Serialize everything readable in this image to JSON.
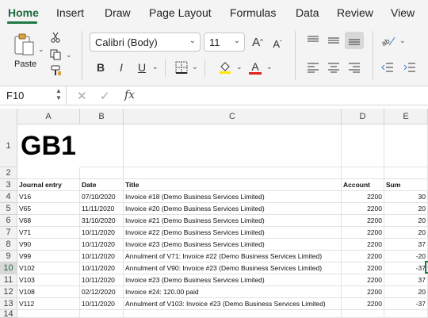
{
  "ribbon_tabs": [
    "Home",
    "Insert",
    "Draw",
    "Page Layout",
    "Formulas",
    "Data",
    "Review",
    "View"
  ],
  "ribbon": {
    "paste_label": "Paste",
    "font_name": "Calibri (Body)",
    "font_size": "11",
    "bold": "B",
    "italic": "I",
    "underline": "U",
    "grow_font": "A^",
    "shrink_font": "Aˇ",
    "font_color_letter": "A",
    "highlight_color": "#ffe600",
    "font_color": "#e02020"
  },
  "formula_bar": {
    "name_box": "F10",
    "fx": "fx",
    "formula": ""
  },
  "columns": [
    "A",
    "B",
    "C",
    "D",
    "E"
  ],
  "rows": [
    "1",
    "2",
    "3",
    "4",
    "5",
    "6",
    "7",
    "8",
    "9",
    "10",
    "11",
    "12",
    "13",
    "14"
  ],
  "selected_row": "10",
  "sheet": {
    "title": "GB1",
    "headers": {
      "journal": "Journal entry",
      "date": "Date",
      "title": "Title",
      "account": "Account",
      "sum": "Sum"
    },
    "entries": [
      {
        "journal": "V16",
        "date": "07/10/2020",
        "title": "Invoice #18 (Demo Business Services Limited)",
        "account": "2200",
        "sum": "30"
      },
      {
        "journal": "V65",
        "date": "11/11/2020",
        "title": "Invoice #20 (Demo Business Services Limited)",
        "account": "2200",
        "sum": "20"
      },
      {
        "journal": "V68",
        "date": "31/10/2020",
        "title": "Invoice #21 (Demo Business Services Limited)",
        "account": "2200",
        "sum": "20"
      },
      {
        "journal": "V71",
        "date": "10/11/2020",
        "title": "Invoice #22 (Demo Business Services Limited)",
        "account": "2200",
        "sum": "20"
      },
      {
        "journal": "V90",
        "date": "10/11/2020",
        "title": "Invoice #23 (Demo Business Services Limited)",
        "account": "2200",
        "sum": "37"
      },
      {
        "journal": "V99",
        "date": "10/11/2020",
        "title": "Annulment of V71: Invoice #22 (Demo Business Services Limited)",
        "account": "2200",
        "sum": "-20"
      },
      {
        "journal": "V102",
        "date": "10/11/2020",
        "title": "Annulment of V90: Invoice #23 (Demo Business Services Limited)",
        "account": "2200",
        "sum": "-37"
      },
      {
        "journal": "V103",
        "date": "10/11/2020",
        "title": "Invoice #23 (Demo Business Services Limited)",
        "account": "2200",
        "sum": "37"
      },
      {
        "journal": "V108",
        "date": "02/12/2020",
        "title": "Invoice #24: 120.00 paid",
        "account": "2200",
        "sum": "20"
      },
      {
        "journal": "V112",
        "date": "10/11/2020",
        "title": "Annulment of V103: Invoice #23 (Demo Business Services Limited)",
        "account": "2200",
        "sum": "-37"
      }
    ]
  }
}
